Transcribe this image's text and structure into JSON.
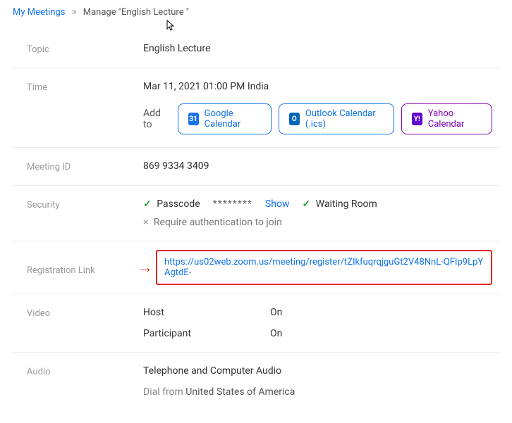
{
  "breadcrumb": {
    "root": "My Meetings",
    "separator": ">",
    "current": "Manage \"English Lecture \""
  },
  "labels": {
    "topic": "Topic",
    "time": "Time",
    "addTo": "Add to",
    "meetingId": "Meeting ID",
    "security": "Security",
    "registrationLink": "Registration Link",
    "video": "Video",
    "audio": "Audio"
  },
  "topic": {
    "value": "English Lecture"
  },
  "time": {
    "value": "Mar 11, 2021 01:00 PM India"
  },
  "calendars": {
    "google": {
      "label": "Google Calendar",
      "icon": "31"
    },
    "outlook": {
      "label": "Outlook Calendar (.ics)",
      "icon": "O"
    },
    "yahoo": {
      "label": "Yahoo Calendar",
      "icon": "Y!"
    }
  },
  "meetingId": {
    "value": "869 9334 3409"
  },
  "security": {
    "passcodeLabel": "Passcode",
    "passcodeMask": "********",
    "showLabel": "Show",
    "waitingRoomLabel": "Waiting Room",
    "authLabel": "Require authentication to join"
  },
  "registration": {
    "url": "https://us02web.zoom.us/meeting/register/tZIkfuqrqjguGt2V48NnL-QFIp9LpYAgtdE-"
  },
  "video": {
    "hostLabel": "Host",
    "hostValue": "On",
    "participantLabel": "Participant",
    "participantValue": "On"
  },
  "audio": {
    "value": "Telephone and Computer Audio",
    "dialPrefix": "Dial from ",
    "dialCountry": "United States of America"
  },
  "annotation": {
    "arrow": "→"
  }
}
